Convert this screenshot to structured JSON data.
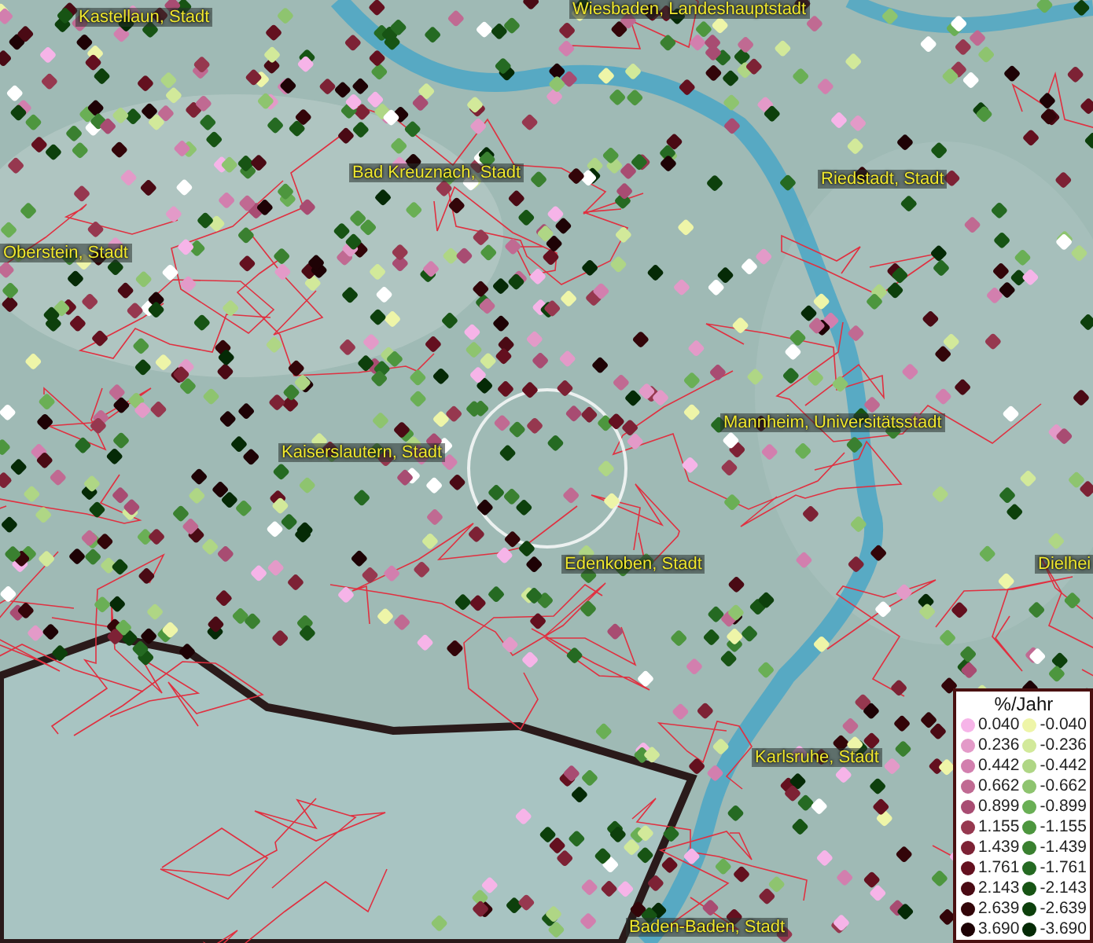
{
  "map": {
    "places": [
      {
        "name": "Kastellaun, Stadt"
      },
      {
        "name": "Wiesbaden, Landeshauptstadt"
      },
      {
        "name": "Bad Kreuznach, Stadt"
      },
      {
        "name": "Riedstadt, Stadt"
      },
      {
        "name": "Oberstein, Stadt"
      },
      {
        "name": "Kaiserslautern, Stadt"
      },
      {
        "name": "Mannheim, Universitätsstadt"
      },
      {
        "name": "Edenkoben, Stadt"
      },
      {
        "name": "Dielhei"
      },
      {
        "name": "Karlsruhe, Stadt"
      },
      {
        "name": "Baden-Baden, Stadt"
      }
    ]
  },
  "legend": {
    "title": "%/Jahr",
    "rows": [
      {
        "up": {
          "label": "0.040",
          "color": "#f6b4e8"
        },
        "down": {
          "label": "-0.040",
          "color": "#eef5a8"
        }
      },
      {
        "up": {
          "label": "0.236",
          "color": "#e39ac8"
        },
        "down": {
          "label": "-0.236",
          "color": "#d2e99a"
        }
      },
      {
        "up": {
          "label": "0.442",
          "color": "#d27fae"
        },
        "down": {
          "label": "-0.442",
          "color": "#afd685"
        }
      },
      {
        "up": {
          "label": "0.662",
          "color": "#c06a92"
        },
        "down": {
          "label": "-0.662",
          "color": "#8ec46f"
        }
      },
      {
        "up": {
          "label": "0.899",
          "color": "#a84c72"
        },
        "down": {
          "label": "-0.899",
          "color": "#6aaf55"
        }
      },
      {
        "up": {
          "label": "1.155",
          "color": "#96384f"
        },
        "down": {
          "label": "-1.155",
          "color": "#4d963e"
        }
      },
      {
        "up": {
          "label": "1.439",
          "color": "#7d2235"
        },
        "down": {
          "label": "-1.439",
          "color": "#3a8030"
        }
      },
      {
        "up": {
          "label": "1.761",
          "color": "#64101f"
        },
        "down": {
          "label": "-1.761",
          "color": "#256a22"
        }
      },
      {
        "up": {
          "label": "2.143",
          "color": "#4a0a14"
        },
        "down": {
          "label": "-2.143",
          "color": "#175414"
        }
      },
      {
        "up": {
          "label": "2.639",
          "color": "#330509"
        },
        "down": {
          "label": "-2.639",
          "color": "#0d400c"
        }
      },
      {
        "up": {
          "label": "3.690",
          "color": "#1e0205"
        },
        "down": {
          "label": "-3.690",
          "color": "#052a06"
        }
      }
    ]
  }
}
